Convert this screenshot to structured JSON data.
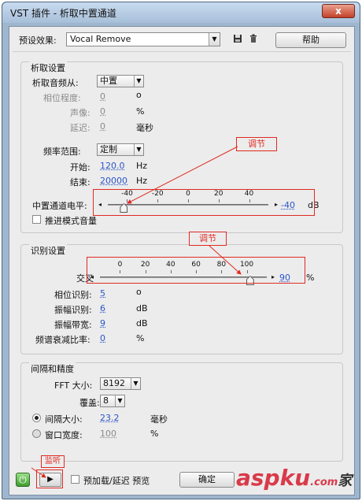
{
  "window": {
    "title": "VST 插件 - 析取中置通道",
    "close_glyph": "x"
  },
  "preset": {
    "label": "预设效果:",
    "value": "Vocal Remove",
    "save_icon": "save-icon",
    "delete_icon": "trash-icon",
    "help_label": "帮助"
  },
  "extract": {
    "title": "析取设置",
    "source_label": "析取音频从:",
    "source_value": "中置",
    "phase_label": "相位程度:",
    "phase_value": "0",
    "phase_unit": "o",
    "pan_label": "声像:",
    "pan_value": "0",
    "pan_unit": "%",
    "delay_label": "延迟:",
    "delay_value": "0",
    "delay_unit": "毫秒",
    "freq_label": "频率范围:",
    "freq_value": "定制",
    "start_label": "开始:",
    "start_value": "120.0",
    "start_unit": "Hz",
    "end_label": "结束:",
    "end_value": "20000",
    "end_unit": "Hz",
    "level_label": "中置通道电平:",
    "level_ticks": [
      "-40",
      "-20",
      "0",
      "20",
      "40"
    ],
    "level_value": "-40",
    "level_unit": "dB",
    "level_fraction": 0.1,
    "boost_label": "推进模式音量"
  },
  "detect": {
    "title": "识别设置",
    "cross_label": "交叉",
    "cross_ticks": [
      "0",
      "20",
      "40",
      "60",
      "80",
      "100"
    ],
    "cross_value": "90",
    "cross_unit": "%",
    "cross_fraction": 0.9,
    "phase_label": "相位识别:",
    "phase_value": "5",
    "phase_unit": "o",
    "amp_label": "振幅识别:",
    "amp_value": "6",
    "amp_unit": "dB",
    "bw_label": "振幅带宽:",
    "bw_value": "9",
    "bw_unit": "dB",
    "spec_label": "频谱衰减比率:",
    "spec_value": "0",
    "spec_unit": "%"
  },
  "spacing": {
    "title": "间隔和精度",
    "fft_label": "FFT 大小:",
    "fft_value": "8192",
    "overlap_label": "覆盖:",
    "overlap_value": "8",
    "interval_label": "间隔大小:",
    "interval_value": "23.2",
    "interval_unit": "毫秒",
    "window_label": "窗口宽度:",
    "window_value": "100",
    "window_unit": "%"
  },
  "annotations": {
    "adjust1": "调节",
    "adjust2": "调节",
    "listen": "监听"
  },
  "footer": {
    "power_icon": "power-icon",
    "play_icon": "play-icon",
    "preload_label": "预加载/延迟 预览",
    "ok_label": "确定"
  },
  "watermark": {
    "brand": "aspku",
    "suffix": ".com",
    "cn": "家"
  },
  "colors": {
    "accent_blue": "#2b55c8",
    "annotation_red": "#e02a22",
    "title_bar": "#a7bfd9"
  }
}
